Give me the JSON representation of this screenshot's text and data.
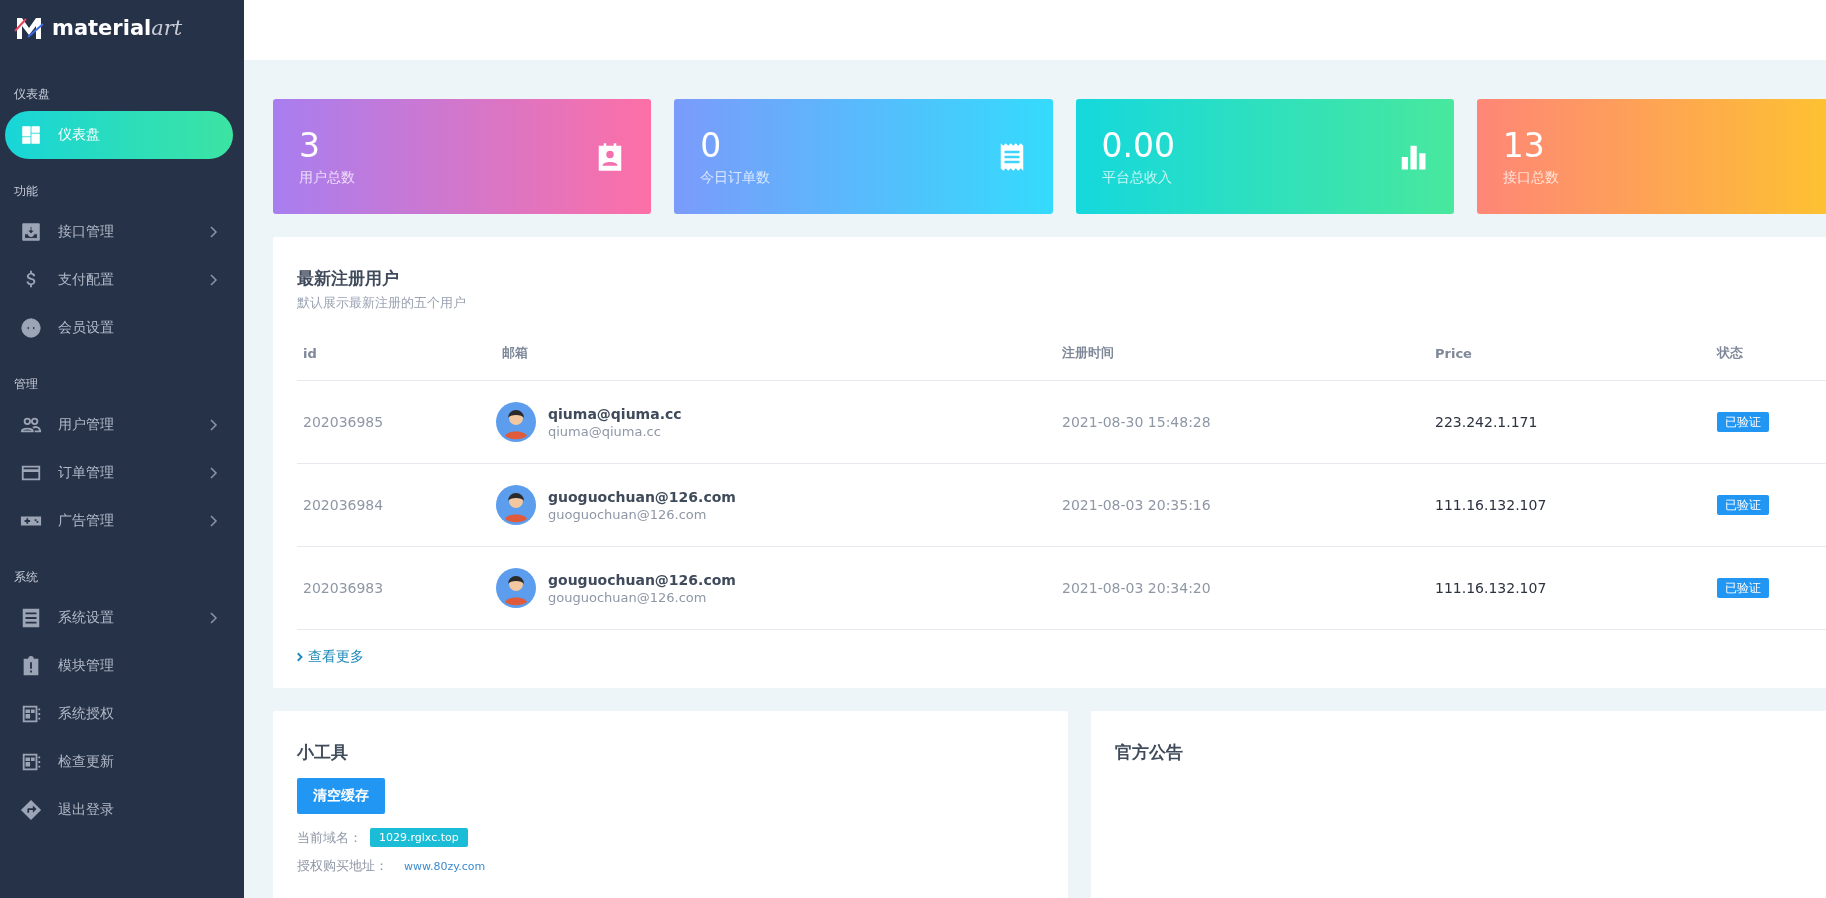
{
  "brand": {
    "name": "material",
    "suffix": "art"
  },
  "sidebar": {
    "sections": [
      {
        "title": "仪表盘",
        "items": [
          {
            "label": "仪表盘",
            "selected": true,
            "expandable": false
          }
        ]
      },
      {
        "title": "功能",
        "items": [
          {
            "label": "接口管理",
            "selected": false,
            "expandable": true
          },
          {
            "label": "支付配置",
            "selected": false,
            "expandable": true
          },
          {
            "label": "会员设置",
            "selected": false,
            "expandable": false
          }
        ]
      },
      {
        "title": "管理",
        "items": [
          {
            "label": "用户管理",
            "selected": false,
            "expandable": true
          },
          {
            "label": "订单管理",
            "selected": false,
            "expandable": true
          },
          {
            "label": "广告管理",
            "selected": false,
            "expandable": true
          }
        ]
      },
      {
        "title": "系统",
        "items": [
          {
            "label": "系统设置",
            "selected": false,
            "expandable": true
          },
          {
            "label": "模块管理",
            "selected": false,
            "expandable": false
          },
          {
            "label": "系统授权",
            "selected": false,
            "expandable": false
          },
          {
            "label": "检查更新",
            "selected": false,
            "expandable": false
          },
          {
            "label": "退出登录",
            "selected": false,
            "expandable": false
          }
        ]
      }
    ]
  },
  "stats": [
    {
      "value": "3",
      "label": "用户总数"
    },
    {
      "value": "0",
      "label": "今日订单数"
    },
    {
      "value": "0.00",
      "label": "平台总收入"
    },
    {
      "value": "13",
      "label": "接口总数"
    }
  ],
  "latest_users": {
    "title": "最新注册用户",
    "subtitle": "默认展示最新注册的五个用户",
    "columns": [
      "id",
      "邮箱",
      "注册时间",
      "Price",
      "状态"
    ],
    "rows": [
      {
        "id": "202036985",
        "email": "qiuma@qiuma.cc",
        "email_sub": "qiuma@qiuma.cc",
        "registered": "2021-08-30 15:48:28",
        "price": "223.242.1.171",
        "status": "已验证"
      },
      {
        "id": "202036984",
        "email": "guoguochuan@126.com",
        "email_sub": "guoguochuan@126.com",
        "registered": "2021-08-03 20:35:16",
        "price": "111.16.132.107",
        "status": "已验证"
      },
      {
        "id": "202036983",
        "email": "gouguochuan@126.com",
        "email_sub": "gouguochuan@126.com",
        "registered": "2021-08-03 20:34:20",
        "price": "111.16.132.107",
        "status": "已验证"
      }
    ],
    "more_link": "查看更多"
  },
  "tools": {
    "title": "小工具",
    "button": "清空缓存",
    "domain_label": "当前域名：",
    "domain": "1029.rglxc.top",
    "purchase_label": "授权购买地址：",
    "purchase_url": "www.80zy.com"
  },
  "announcement": {
    "title": "官方公告"
  }
}
